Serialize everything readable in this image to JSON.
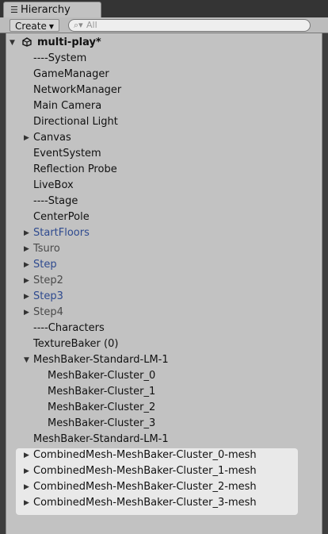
{
  "tab": {
    "icon": "list-icon",
    "label": "Hierarchy"
  },
  "toolbar": {
    "create_label": "Create",
    "search_icon": "search-icon",
    "search_placeholder": "All"
  },
  "scene": {
    "name": "multi-play*",
    "icon": "unity-logo-icon"
  },
  "items": [
    {
      "label": "----System"
    },
    {
      "label": "GameManager"
    },
    {
      "label": "NetworkManager"
    },
    {
      "label": "Main Camera"
    },
    {
      "label": "Directional Light"
    },
    {
      "label": "Canvas",
      "arrow": "collapsed"
    },
    {
      "label": "EventSystem"
    },
    {
      "label": "Reflection Probe"
    },
    {
      "label": "LiveBox"
    },
    {
      "label": "----Stage"
    },
    {
      "label": "CenterPole"
    },
    {
      "label": "StartFloors",
      "arrow": "collapsed",
      "style": "prefab"
    },
    {
      "label": "Tsuro",
      "arrow": "collapsed",
      "style": "dim"
    },
    {
      "label": "Step",
      "arrow": "collapsed",
      "style": "prefab"
    },
    {
      "label": "Step2",
      "arrow": "collapsed",
      "style": "dim"
    },
    {
      "label": "Step3",
      "arrow": "collapsed",
      "style": "prefab"
    },
    {
      "label": "Step4",
      "arrow": "collapsed",
      "style": "dim"
    },
    {
      "label": "----Characters"
    },
    {
      "label": "TextureBaker (0)"
    },
    {
      "label": "MeshBaker-Standard-LM-1",
      "arrow": "expanded"
    },
    {
      "label": "MeshBaker-Cluster_0",
      "indent": 1
    },
    {
      "label": "MeshBaker-Cluster_1",
      "indent": 1
    },
    {
      "label": "MeshBaker-Cluster_2",
      "indent": 1
    },
    {
      "label": "MeshBaker-Cluster_3",
      "indent": 1
    },
    {
      "label": "MeshBaker-Standard-LM-1"
    },
    {
      "label": "CombinedMesh-MeshBaker-Cluster_0-mesh",
      "arrow": "collapsed",
      "selected": true
    },
    {
      "label": "CombinedMesh-MeshBaker-Cluster_1-mesh",
      "arrow": "collapsed",
      "selected": true
    },
    {
      "label": "CombinedMesh-MeshBaker-Cluster_2-mesh",
      "arrow": "collapsed",
      "selected": true
    },
    {
      "label": "CombinedMesh-MeshBaker-Cluster_3-mesh",
      "arrow": "collapsed",
      "selected": true
    }
  ]
}
